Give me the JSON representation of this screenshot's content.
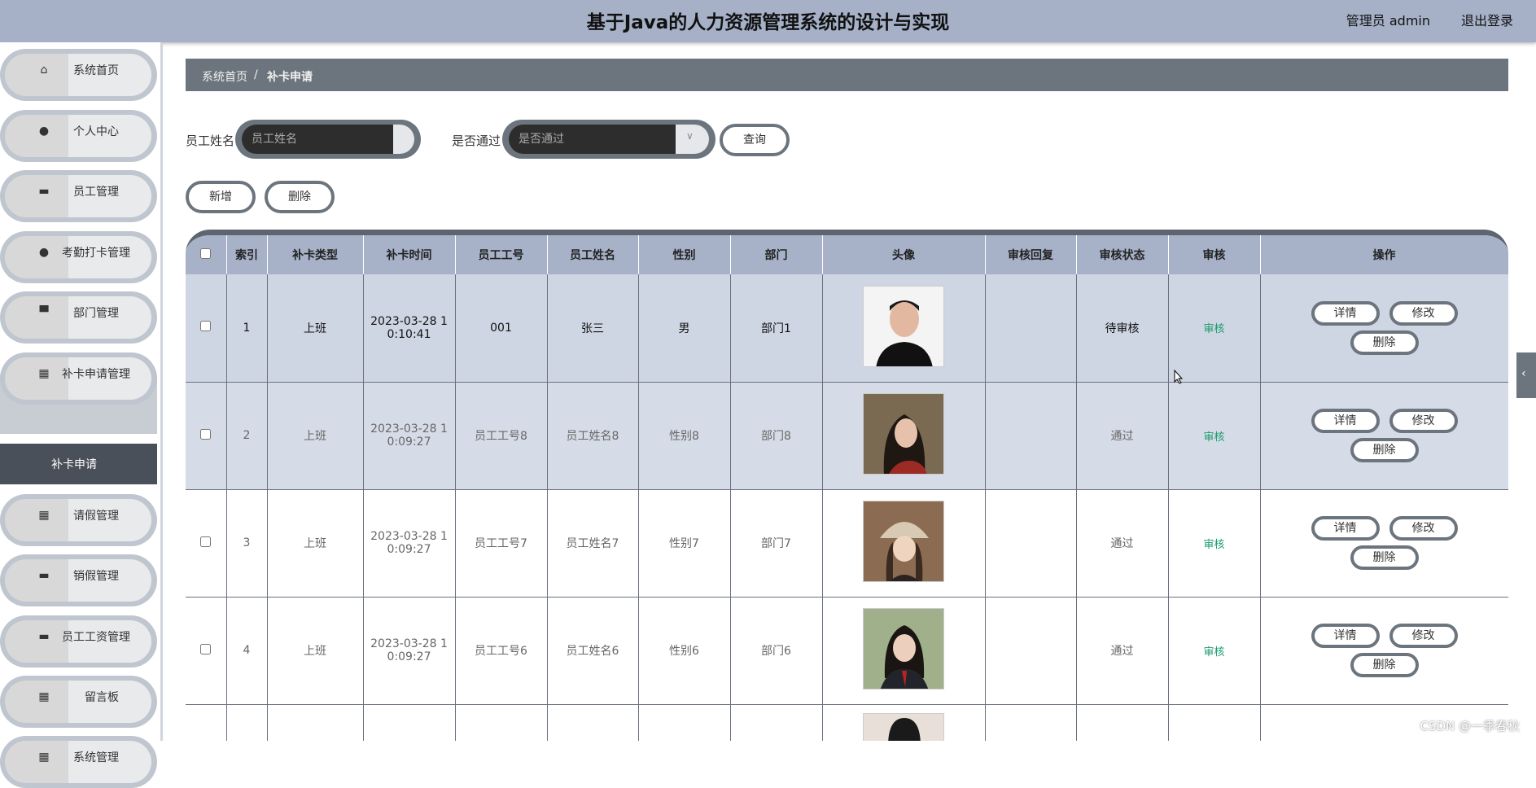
{
  "header": {
    "title": "基于Java的人力资源管理系统的设计与实现",
    "user": "管理员 admin",
    "logout": "退出登录"
  },
  "sidebar": {
    "items": [
      {
        "label": "系统首页",
        "icon": "home-icon"
      },
      {
        "label": "个人中心",
        "icon": "user-icon"
      },
      {
        "label": "员工管理",
        "icon": "chat-icon"
      },
      {
        "label": "考勤打卡管理",
        "icon": "pin-icon"
      },
      {
        "label": "部门管理",
        "icon": "building-icon"
      },
      {
        "label": "补卡申请管理",
        "icon": "grid-icon"
      },
      {
        "label": "请假管理",
        "icon": "grid-icon"
      },
      {
        "label": "销假管理",
        "icon": "monitor-icon"
      },
      {
        "label": "员工工资管理",
        "icon": "printer-icon"
      },
      {
        "label": "留言板",
        "icon": "grid-icon"
      },
      {
        "label": "系统管理",
        "icon": "grid-icon"
      }
    ],
    "submenu": "补卡申请"
  },
  "breadcrumb": {
    "home": "系统首页",
    "separator": "/",
    "current": "补卡申请"
  },
  "search": {
    "name_label": "员工姓名",
    "name_placeholder": "员工姓名",
    "pass_label": "是否通过",
    "pass_placeholder": "是否通过",
    "query_button": "查询"
  },
  "toolbar": {
    "add": "新增",
    "delete": "删除"
  },
  "table": {
    "headers": [
      "索引",
      "补卡类型",
      "补卡时间",
      "员工工号",
      "员工姓名",
      "性别",
      "部门",
      "头像",
      "审核回复",
      "审核状态",
      "审核",
      "操作"
    ],
    "rows": [
      {
        "index": "1",
        "type": "上班",
        "time1": "2023-03-28 1",
        "time2": "0:10:41",
        "emp_no": "001",
        "emp_name": "张三",
        "gender": "男",
        "dept": "部门1",
        "reply": "",
        "status": "待审核",
        "audit": "审核"
      },
      {
        "index": "2",
        "type": "上班",
        "time1": "2023-03-28 1",
        "time2": "0:09:27",
        "emp_no": "员工工号8",
        "emp_name": "员工姓名8",
        "gender": "性别8",
        "dept": "部门8",
        "reply": "",
        "status": "通过",
        "audit": "审核"
      },
      {
        "index": "3",
        "type": "上班",
        "time1": "2023-03-28 1",
        "time2": "0:09:27",
        "emp_no": "员工工号7",
        "emp_name": "员工姓名7",
        "gender": "性别7",
        "dept": "部门7",
        "reply": "",
        "status": "通过",
        "audit": "审核"
      },
      {
        "index": "4",
        "type": "上班",
        "time1": "2023-03-28 1",
        "time2": "0:09:27",
        "emp_no": "员工工号6",
        "emp_name": "员工姓名6",
        "gender": "性别6",
        "dept": "部门6",
        "reply": "",
        "status": "通过",
        "audit": "审核"
      }
    ],
    "actions": {
      "detail": "详情",
      "edit": "修改",
      "delete": "删除"
    }
  },
  "watermark": "CSDN @一季春秋"
}
